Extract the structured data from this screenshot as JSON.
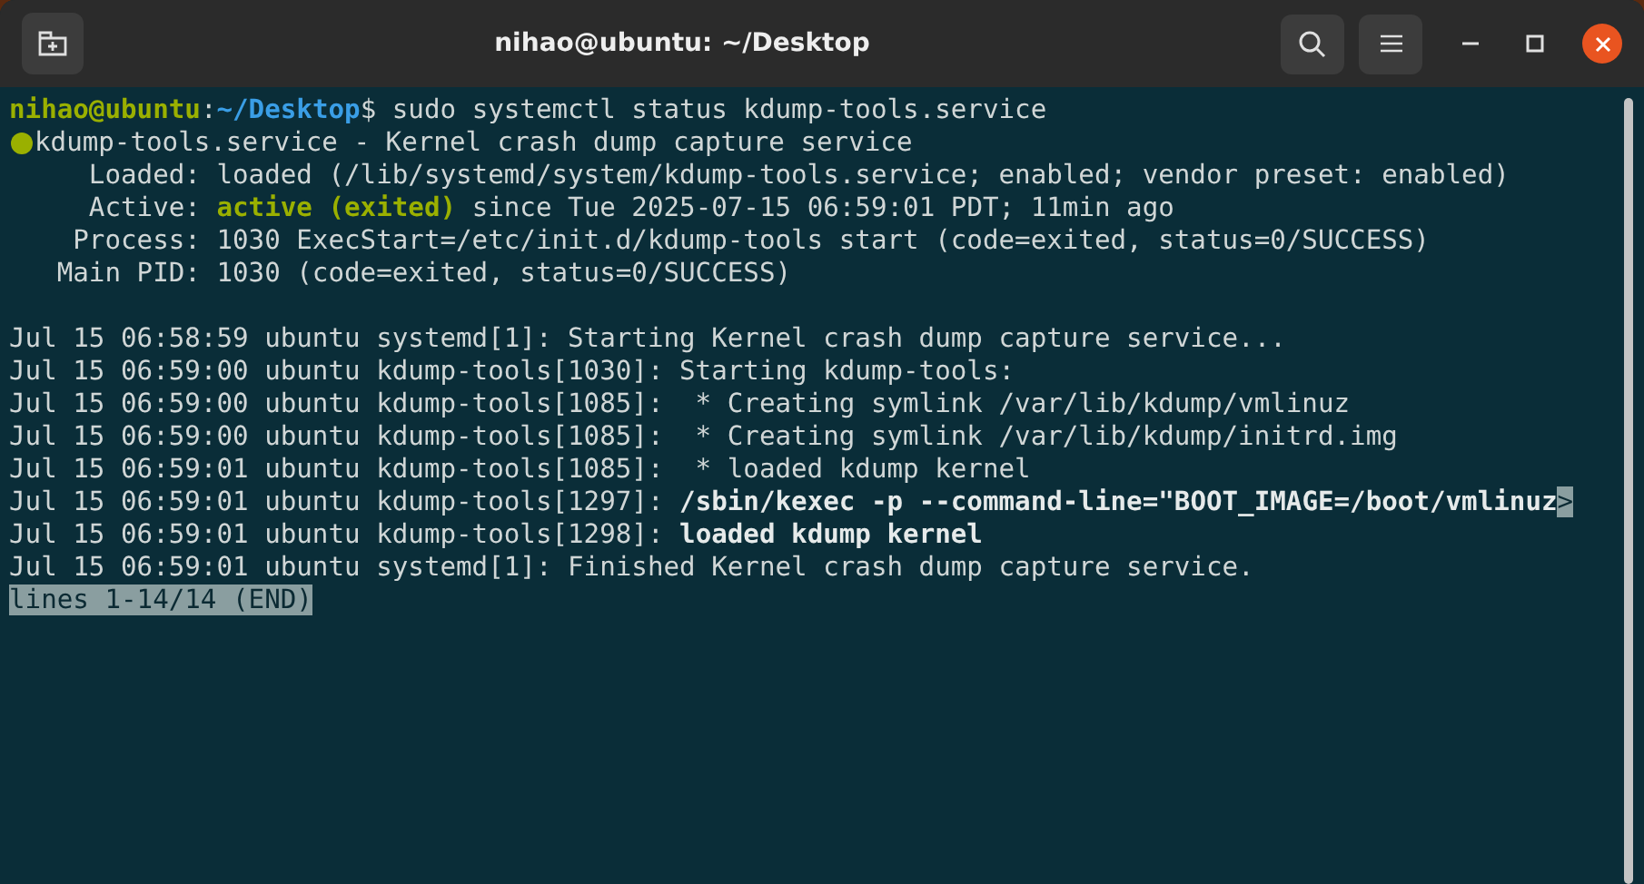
{
  "window": {
    "title": "nihao@ubuntu: ~/Desktop"
  },
  "terminal": {
    "lines": [
      {
        "kind": "text",
        "segments": [
          {
            "text": "nihao@ubuntu",
            "kind": "green"
          },
          {
            "text": ":",
            "kind": "plain"
          },
          {
            "text": "~/Desktop",
            "kind": "blue"
          },
          {
            "text": "$ sudo systemctl status kdump-tools.service",
            "kind": "plain"
          }
        ]
      },
      {
        "kind": "status",
        "color": "#9ab000",
        "segments": [
          {
            "text": "kdump-tools.service - Kernel crash dump capture service",
            "kind": "plain"
          }
        ]
      },
      {
        "kind": "text",
        "segments": [
          {
            "text": "     Loaded: loaded (/lib/systemd/system/kdump-tools.service; enabled; vendor preset: enabled)",
            "kind": "plain"
          }
        ]
      },
      {
        "kind": "text",
        "segments": [
          {
            "text": "     Active: ",
            "kind": "plain"
          },
          {
            "text": "active (exited)",
            "kind": "green"
          },
          {
            "text": " since Tue 2025-07-15 06:59:01 PDT; 11min ago",
            "kind": "plain"
          }
        ]
      },
      {
        "kind": "text",
        "segments": [
          {
            "text": "    Process: 1030 ExecStart=/etc/init.d/kdump-tools start (code=exited, status=0/SUCCESS)",
            "kind": "plain"
          }
        ]
      },
      {
        "kind": "text",
        "segments": [
          {
            "text": "   Main PID: 1030 (code=exited, status=0/SUCCESS)",
            "kind": "plain"
          }
        ]
      },
      {
        "kind": "blank"
      },
      {
        "kind": "text",
        "segments": [
          {
            "text": "Jul 15 06:58:59 ubuntu systemd[1]: Starting Kernel crash dump capture service...",
            "kind": "plain"
          }
        ]
      },
      {
        "kind": "text",
        "segments": [
          {
            "text": "Jul 15 06:59:00 ubuntu kdump-tools[1030]: Starting kdump-tools:",
            "kind": "plain"
          }
        ]
      },
      {
        "kind": "text",
        "segments": [
          {
            "text": "Jul 15 06:59:00 ubuntu kdump-tools[1085]:  * Creating symlink /var/lib/kdump/vmlinuz",
            "kind": "plain"
          }
        ]
      },
      {
        "kind": "text",
        "segments": [
          {
            "text": "Jul 15 06:59:00 ubuntu kdump-tools[1085]:  * Creating symlink /var/lib/kdump/initrd.img",
            "kind": "plain"
          }
        ]
      },
      {
        "kind": "text",
        "segments": [
          {
            "text": "Jul 15 06:59:01 ubuntu kdump-tools[1085]:  * loaded kdump kernel",
            "kind": "plain"
          }
        ]
      },
      {
        "kind": "text",
        "segments": [
          {
            "text": "Jul 15 06:59:01 ubuntu kdump-tools[1297]: ",
            "kind": "plain"
          },
          {
            "text": "/sbin/kexec -p --command-line=\"BOOT_IMAGE=/boot/vmlinuz",
            "kind": "bold"
          },
          {
            "text": ">",
            "kind": "highlight"
          }
        ]
      },
      {
        "kind": "text",
        "segments": [
          {
            "text": "Jul 15 06:59:01 ubuntu kdump-tools[1298]: ",
            "kind": "plain"
          },
          {
            "text": "loaded kdump kernel",
            "kind": "bold"
          }
        ]
      },
      {
        "kind": "text",
        "segments": [
          {
            "text": "Jul 15 06:59:01 ubuntu systemd[1]: Finished Kernel crash dump capture service.",
            "kind": "plain"
          }
        ]
      },
      {
        "kind": "text",
        "segments": [
          {
            "text": "lines 1-14/14 (END)",
            "kind": "highlight"
          }
        ]
      }
    ]
  }
}
